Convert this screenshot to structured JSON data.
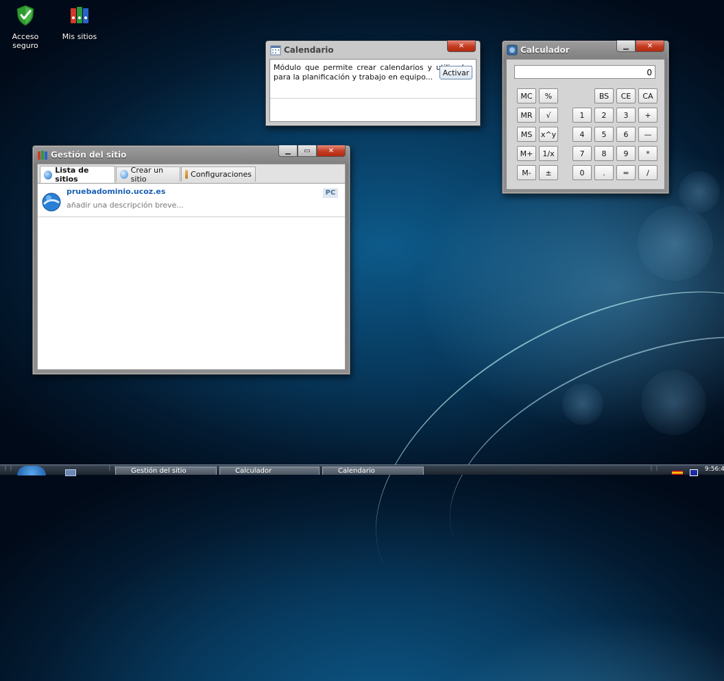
{
  "desktop": {
    "icons": [
      {
        "label": "Acceso\nseguro",
        "icon": "shield-check-icon"
      },
      {
        "label": "Mis sitios",
        "icon": "binders-icon"
      }
    ]
  },
  "calendario": {
    "title": "Calendario",
    "description": "Módulo que permite crear calendarios y utilizarlos para la planificación y trabajo en equipo...",
    "activate_label": "Activar"
  },
  "calculadora": {
    "title": "Calculador",
    "display": "0",
    "keys": {
      "mc": "MC",
      "percent": "%",
      "bs": "BS",
      "ce": "CE",
      "ca": "CA",
      "mr": "MR",
      "sqrt": "√",
      "k1": "1",
      "k2": "2",
      "k3": "3",
      "plus": "+",
      "ms": "MS",
      "pow": "x^y",
      "k4": "4",
      "k5": "5",
      "k6": "6",
      "minus": "—",
      "mplus": "M+",
      "inv": "1/x",
      "k7": "7",
      "k8": "8",
      "k9": "9",
      "mul": "*",
      "mminus": "M-",
      "sign": "±",
      "k0": "0",
      "dot": ".",
      "eq": "=",
      "div": "/"
    }
  },
  "gestion": {
    "title": "Gestión del sitio",
    "tabs": [
      "Lista de sitios",
      "Crear un sitio",
      "Configuraciones"
    ],
    "sites": [
      {
        "domain": "pruebadominio.ucoz.es",
        "description": "añadir una descripción breve...",
        "badge": "PC"
      }
    ]
  },
  "taskbar": {
    "items": [
      "Gestión del sitio",
      "Calculador",
      "Calendario"
    ],
    "clock": "9:56:4"
  },
  "colors": {
    "close_button": "#c43b20",
    "link": "#1a5fb4",
    "badge_bg": "#dfe8f2",
    "badge_text": "#4a6f9a"
  }
}
